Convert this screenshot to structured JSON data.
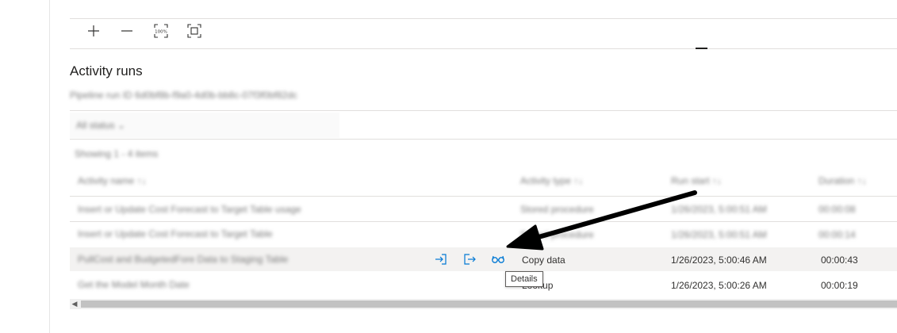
{
  "canvas_toolbar": {
    "zoom_in": "zoom-in-icon",
    "zoom_out": "zoom-out-icon",
    "zoom_100": "zoom-100-icon",
    "fit_to_screen": "fit-to-screen-icon",
    "zoom_100_text": "100%"
  },
  "activity_runs": {
    "title": "Activity runs",
    "pipeline_run_id": "Pipeline run ID 6d0bf8b-f9a0-4d0b-bb8c-07f3f0bf82dc",
    "filter_label": "All status ⌄",
    "showing": "Showing 1 - 4 items",
    "columns": [
      {
        "label": "Activity name"
      },
      {
        "label": "Activity type"
      },
      {
        "label": "Run start"
      },
      {
        "label": "Duration"
      }
    ],
    "rows": [
      {
        "name": "Insert or Update Cost Forecast to Target Table usage",
        "type": "Stored procedure",
        "start": "1/26/2023, 5:00:51 AM",
        "duration": "00:00:08",
        "clear": false
      },
      {
        "name": "Insert or Update Cost Forecast to Target Table",
        "type": "Stored procedure",
        "start": "1/26/2023, 5:00:51 AM",
        "duration": "00:00:14",
        "clear": false
      },
      {
        "name": "PullCost and BudgetedFore Data to Staging Table",
        "type": "Copy data",
        "start": "1/26/2023, 5:00:46 AM",
        "duration": "00:00:43",
        "clear": true
      },
      {
        "name": "Get the Model Month Date",
        "type": "Lookup",
        "start": "1/26/2023, 5:00:26 AM",
        "duration": "00:00:19",
        "clear": true
      }
    ],
    "row_actions": {
      "input_icon": "input-icon",
      "output_icon": "output-icon",
      "details_icon": "glasses-details-icon"
    },
    "tooltip": "Details"
  },
  "annotation": {
    "arrow_color": "#000000"
  },
  "colors": {
    "accent": "#0078d4",
    "row_highlight": "#f3f2f1",
    "divider": "#e1dfdd"
  }
}
